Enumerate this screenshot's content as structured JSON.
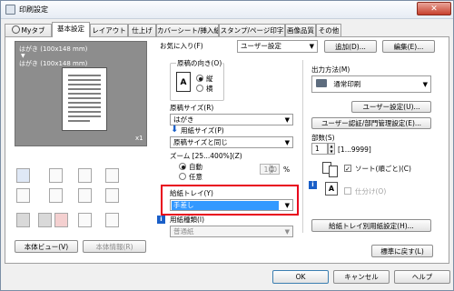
{
  "window": {
    "title": "印刷設定",
    "close_glyph": "✕"
  },
  "tabs": [
    {
      "label": "Myタブ"
    },
    {
      "label": "基本設定"
    },
    {
      "label": "レイアウト"
    },
    {
      "label": "仕上げ"
    },
    {
      "label": "カバーシート/挿入紙"
    },
    {
      "label": "スタンプ/ページ印字"
    },
    {
      "label": "画像品質"
    },
    {
      "label": "その他"
    }
  ],
  "preview": {
    "caption": "はがき (100x148 mm)",
    "arrow": "▼",
    "caption2": "はがき (100x148 mm)",
    "scale": "x1"
  },
  "left_buttons": {
    "view": "本体ビュー(V)",
    "info": "本体情報(R)"
  },
  "favorites": {
    "label": "お気に入り(F)",
    "value": "ユーザー設定",
    "add": "追加(D)...",
    "edit": "編集(E)..."
  },
  "orientation": {
    "label": "原稿の向き(O)",
    "portrait": "縦",
    "landscape": "横"
  },
  "original_size": {
    "label": "原稿サイズ(R)",
    "value": "はがき"
  },
  "paper_size": {
    "label": "用紙サイズ(P)",
    "value": "原稿サイズと同じ"
  },
  "zoom": {
    "label": "ズーム [25...400%](Z)",
    "auto": "自動",
    "any": "任意",
    "value": "100",
    "unit": "%"
  },
  "tray": {
    "label": "給紙トレイ(Y)",
    "value": "手差し"
  },
  "paper_type": {
    "label": "用紙種類(I)",
    "value": "普通紙"
  },
  "output": {
    "label": "出力方法(M)",
    "value": "通常印刷",
    "user_settings": "ユーザー設定(U)...",
    "auth": "ユーザー認証/部門管理設定(E)..."
  },
  "copies": {
    "label": "部数(S)",
    "value": "1",
    "range": "[1...9999]"
  },
  "collate": {
    "label": "ソート(順ごと)(C)"
  },
  "offset": {
    "label": "仕分け(O)"
  },
  "tray_settings": "給紙トレイ別用紙設定(H)...",
  "restore": "標準に戻す(L)",
  "footer": {
    "ok": "OK",
    "cancel": "キャンセル",
    "help": "ヘルプ"
  },
  "colors": {
    "accent": "#3399ff",
    "highlight_border": "#e8001c",
    "preview_bg": "#8d8d8d",
    "titlebar": "#e6ecf4"
  }
}
